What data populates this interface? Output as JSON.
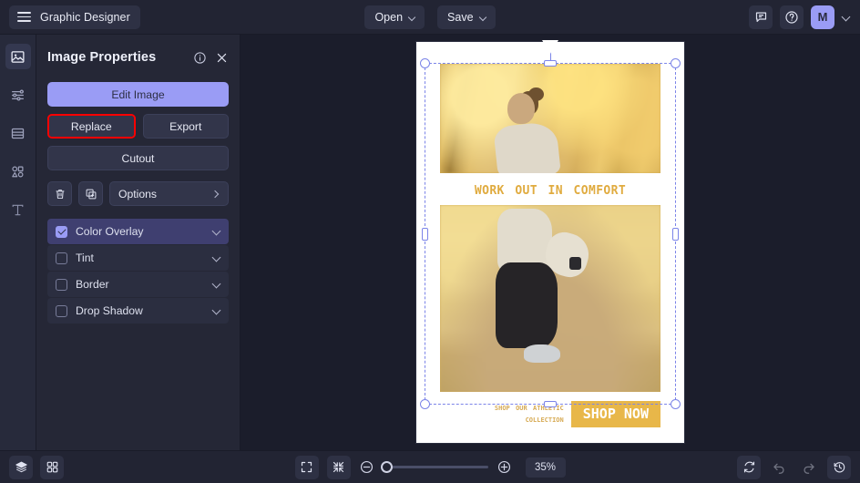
{
  "topbar": {
    "brand": "Graphic Designer",
    "menus": [
      {
        "label": "Open",
        "icon": "chevron-down-icon"
      },
      {
        "label": "Save",
        "icon": "chevron-down-icon"
      }
    ],
    "right_icons": [
      "comment-icon",
      "help-icon"
    ],
    "avatar_initial": "M"
  },
  "rail": {
    "items": [
      {
        "name": "image-tool",
        "icon": "image-icon",
        "active": true
      },
      {
        "name": "adjustments-tool",
        "icon": "sliders-icon",
        "active": false
      },
      {
        "name": "layout-tool",
        "icon": "layout-icon",
        "active": false
      },
      {
        "name": "shapes-tool",
        "icon": "shapes-icon",
        "active": false
      },
      {
        "name": "text-tool",
        "icon": "text-icon",
        "active": false
      }
    ]
  },
  "panel": {
    "title": "Image Properties",
    "info_icon": "info-icon",
    "close_icon": "close-icon",
    "primary_button": "Edit Image",
    "replace_button": "Replace",
    "export_button": "Export",
    "cutout_button": "Cutout",
    "delete_icon": "trash-icon",
    "duplicate_icon": "duplicate-icon",
    "options_label": "Options",
    "options_chevron": "chevron-right-icon",
    "effects": [
      {
        "label": "Color Overlay",
        "checked": true
      },
      {
        "label": "Tint",
        "checked": false
      },
      {
        "label": "Border",
        "checked": false
      },
      {
        "label": "Drop Shadow",
        "checked": false
      }
    ],
    "highlight_color": "#ff0000",
    "accent_color": "#9a9cf5"
  },
  "canvas": {
    "poster": {
      "headline": "work out in comfort",
      "subtext_line1": "shop our athletic",
      "subtext_line2": "collection",
      "cta_label": "SHOP NOW",
      "headline_color": "#e0ab3f",
      "cta_bg_color": "#e8b749"
    },
    "selection_color": "#7b84e8"
  },
  "bottombar": {
    "left_icons": [
      "layers-icon",
      "grid-icon"
    ],
    "fit_icon": "fit-screen-icon",
    "collapse_icon": "collapse-icon",
    "zoom_out_icon": "zoom-out-icon",
    "zoom_in_icon": "zoom-in-icon",
    "zoom_level": "35%",
    "right_icons": [
      "refresh-icon",
      "undo-icon",
      "redo-icon",
      "history-icon"
    ]
  }
}
